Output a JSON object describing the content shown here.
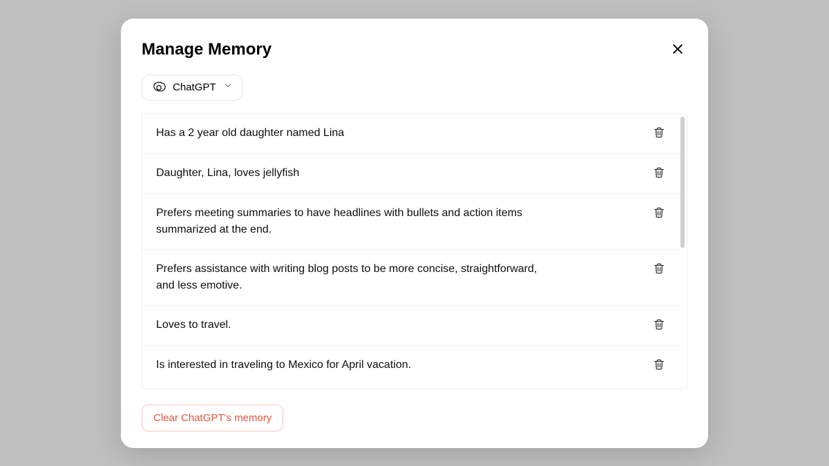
{
  "modal": {
    "title": "Manage Memory",
    "selector": {
      "label": "ChatGPT"
    },
    "clear_button": "Clear ChatGPT's memory"
  },
  "memories": [
    {
      "text": "Has a 2 year old daughter named Lina"
    },
    {
      "text": "Daughter, Lina, loves jellyfish"
    },
    {
      "text": "Prefers meeting summaries to have headlines with bullets and action items summarized at the end."
    },
    {
      "text": "Prefers assistance with writing blog posts to be more concise, straightforward, and less emotive."
    },
    {
      "text": "Loves to travel."
    },
    {
      "text": "Is interested in traveling to Mexico for April vacation."
    }
  ]
}
